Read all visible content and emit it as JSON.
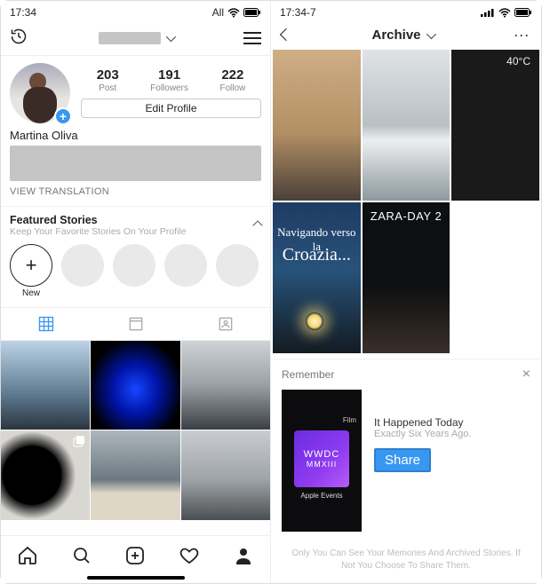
{
  "left": {
    "status": {
      "time": "17:34",
      "carrier": "All"
    },
    "profile": {
      "username_hidden": true,
      "display_name": "Martina Oliva",
      "stats": {
        "posts": {
          "num": "203",
          "label": "Post"
        },
        "followers": {
          "num": "191",
          "label": "Followers"
        },
        "following": {
          "num": "222",
          "label": "Follow"
        }
      },
      "edit_profile_label": "Edit Profile",
      "view_translation_label": "VIEW TRANSLATION"
    },
    "featured": {
      "title": "Featured Stories",
      "subtitle": "Keep Your Favorite Stories On Your Profile",
      "new_label": "New"
    }
  },
  "right": {
    "status": {
      "time": "17:34-7"
    },
    "header": {
      "title": "Archive"
    },
    "tiles": {
      "temp_overlay": "40°C",
      "croatia_line1": "Navigando verso la",
      "croatia_line2": "Croazia...",
      "zara_overlay": "ZARA-DAY 2"
    },
    "remember": {
      "heading": "Remember",
      "close": "×",
      "thumb_line1": "WWDC",
      "thumb_line2": "MMXIII",
      "thumb_caption": "Apple Events",
      "thumb_tag": "Film",
      "title": "It Happened Today",
      "subtitle": "Exactly Six Years Ago.",
      "share_label": "Share"
    },
    "footer": "Only You Can See Your Memories And Archived Stories. If Not You Choose To Share Them."
  }
}
